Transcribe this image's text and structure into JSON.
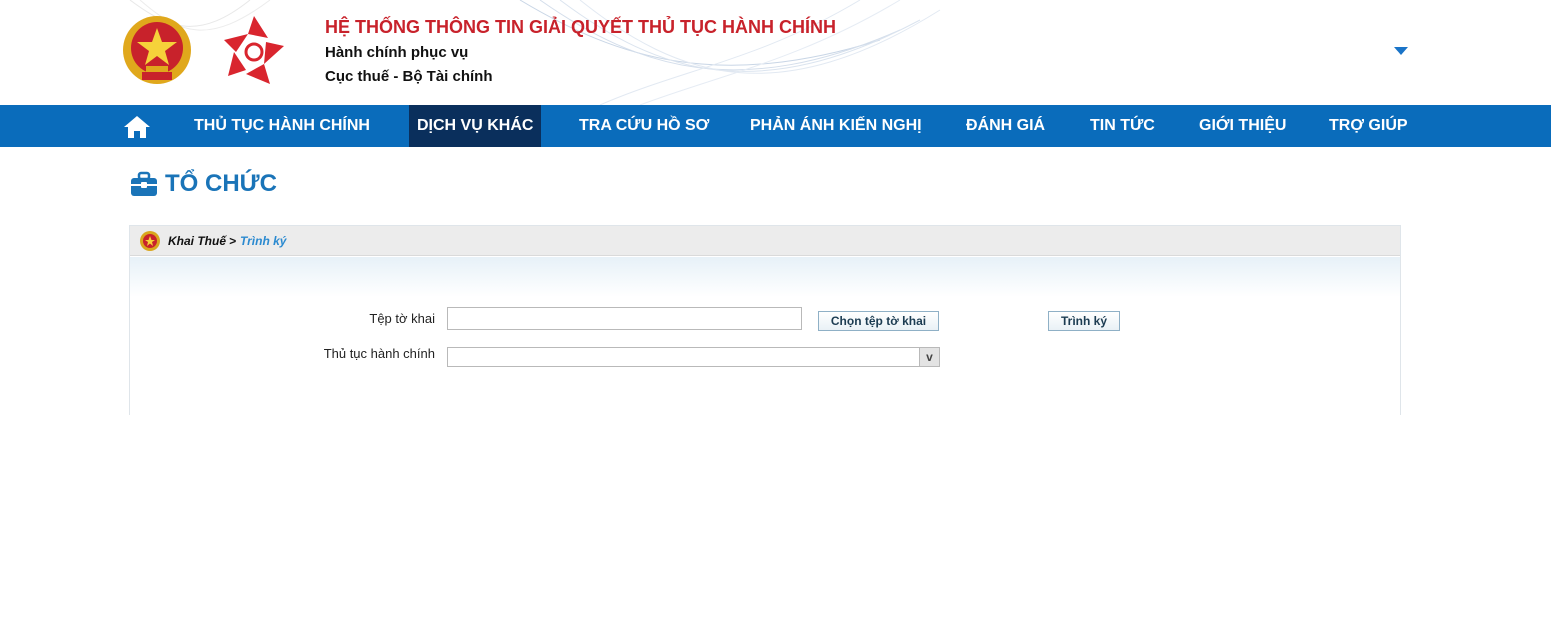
{
  "header": {
    "title": "HỆ THỐNG THÔNG TIN GIẢI QUYẾT THỦ TỤC HÀNH CHÍNH",
    "subtitle1": "Hành chính phục vụ",
    "subtitle2": "Cục thuế - Bộ Tài chính"
  },
  "nav": {
    "items": [
      {
        "label": "THỦ TỤC HÀNH CHÍNH"
      },
      {
        "label": "DỊCH VỤ KHÁC"
      },
      {
        "label": "TRA CỨU HỒ SƠ"
      },
      {
        "label": "PHẢN ÁNH KIẾN NGHỊ"
      },
      {
        "label": "ĐÁNH GIÁ"
      },
      {
        "label": "TIN TỨC"
      },
      {
        "label": "GIỚI THIỆU"
      },
      {
        "label": "TRỢ GIÚP"
      }
    ],
    "active": "DỊCH VỤ KHÁC"
  },
  "page": {
    "title": "TỔ CHỨC"
  },
  "breadcrumb": {
    "root": "Khai Thuế",
    "separator": ">",
    "current": "Trình ký"
  },
  "form": {
    "file_label": "Tệp tờ khai",
    "file_value": "",
    "choose_button": "Chọn tệp tờ khai",
    "submit_button": "Trình ký",
    "procedure_label": "Thủ tục hành chính",
    "procedure_value": "",
    "dropdown_arrow": "v"
  },
  "colors": {
    "brand_red": "#c8222b",
    "nav_blue": "#0a6cbb",
    "nav_active": "#0a2f5c",
    "title_blue": "#1a74b8"
  }
}
